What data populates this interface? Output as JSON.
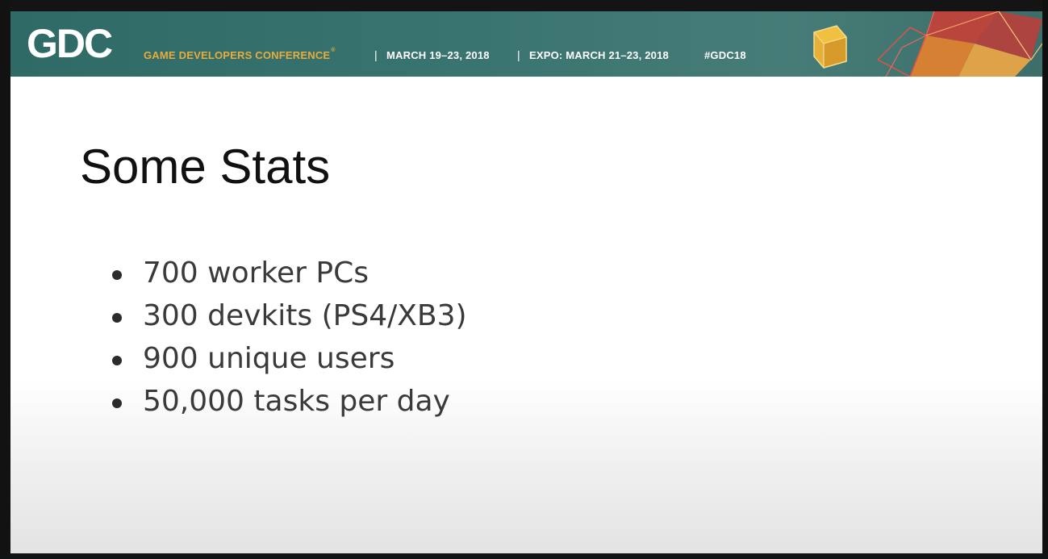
{
  "header": {
    "logo": "GDC",
    "conference_name": "GAME DEVELOPERS CONFERENCE",
    "registered_mark": "®",
    "separator": "|",
    "dates": "MARCH 19–23, 2018",
    "expo": "EXPO: MARCH 21–23, 2018",
    "hashtag": "#GDC18"
  },
  "slide": {
    "title": "Some Stats",
    "bullets": [
      "700 worker PCs",
      "300 devkits (PS4/XB3)",
      "900 unique users",
      "50,000 tasks per day"
    ]
  },
  "colors": {
    "header_teal": "#3a7470",
    "conference_gold": "#e6ad3c",
    "geo_red": "#d9463a",
    "geo_orange": "#e8852d"
  },
  "icons": [
    "cube-icon",
    "geometric-decoration-icon"
  ]
}
